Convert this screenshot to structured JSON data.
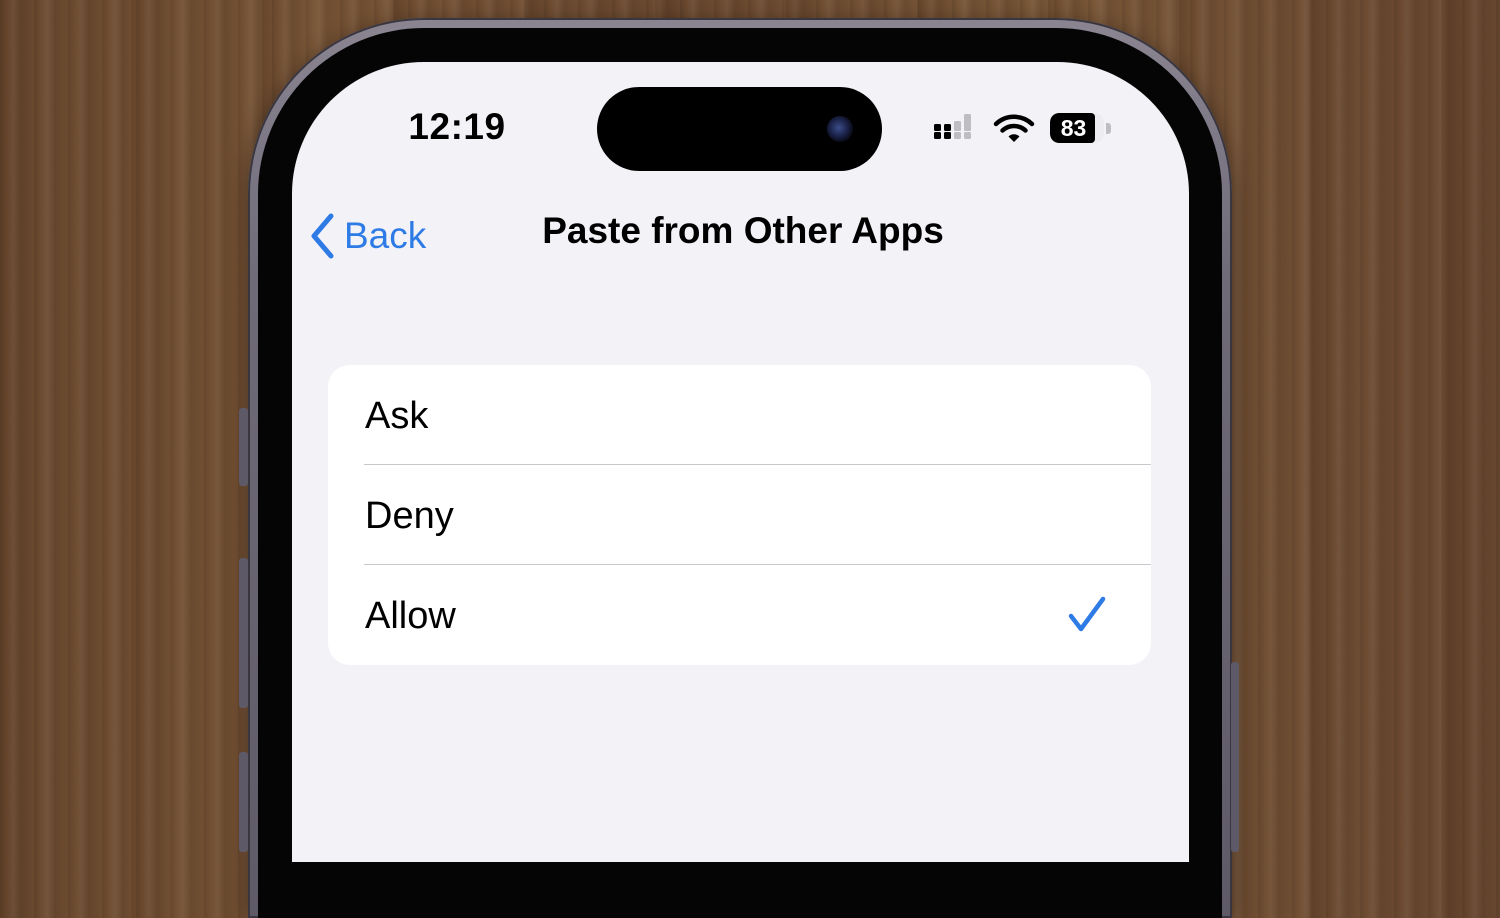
{
  "status_bar": {
    "time": "12:19",
    "battery_level": "83"
  },
  "nav": {
    "back_label": "Back",
    "title": "Paste from Other Apps"
  },
  "options": [
    {
      "label": "Ask",
      "selected": false
    },
    {
      "label": "Deny",
      "selected": false
    },
    {
      "label": "Allow",
      "selected": true
    }
  ],
  "colors": {
    "accent": "#2f7be5",
    "screen_background": "#f2f2f7",
    "card_background": "#ffffff",
    "wood": "#74523a"
  },
  "icons": [
    "chevron-left-icon",
    "cellular-signal-icon",
    "wifi-icon",
    "battery-icon",
    "checkmark-icon"
  ]
}
